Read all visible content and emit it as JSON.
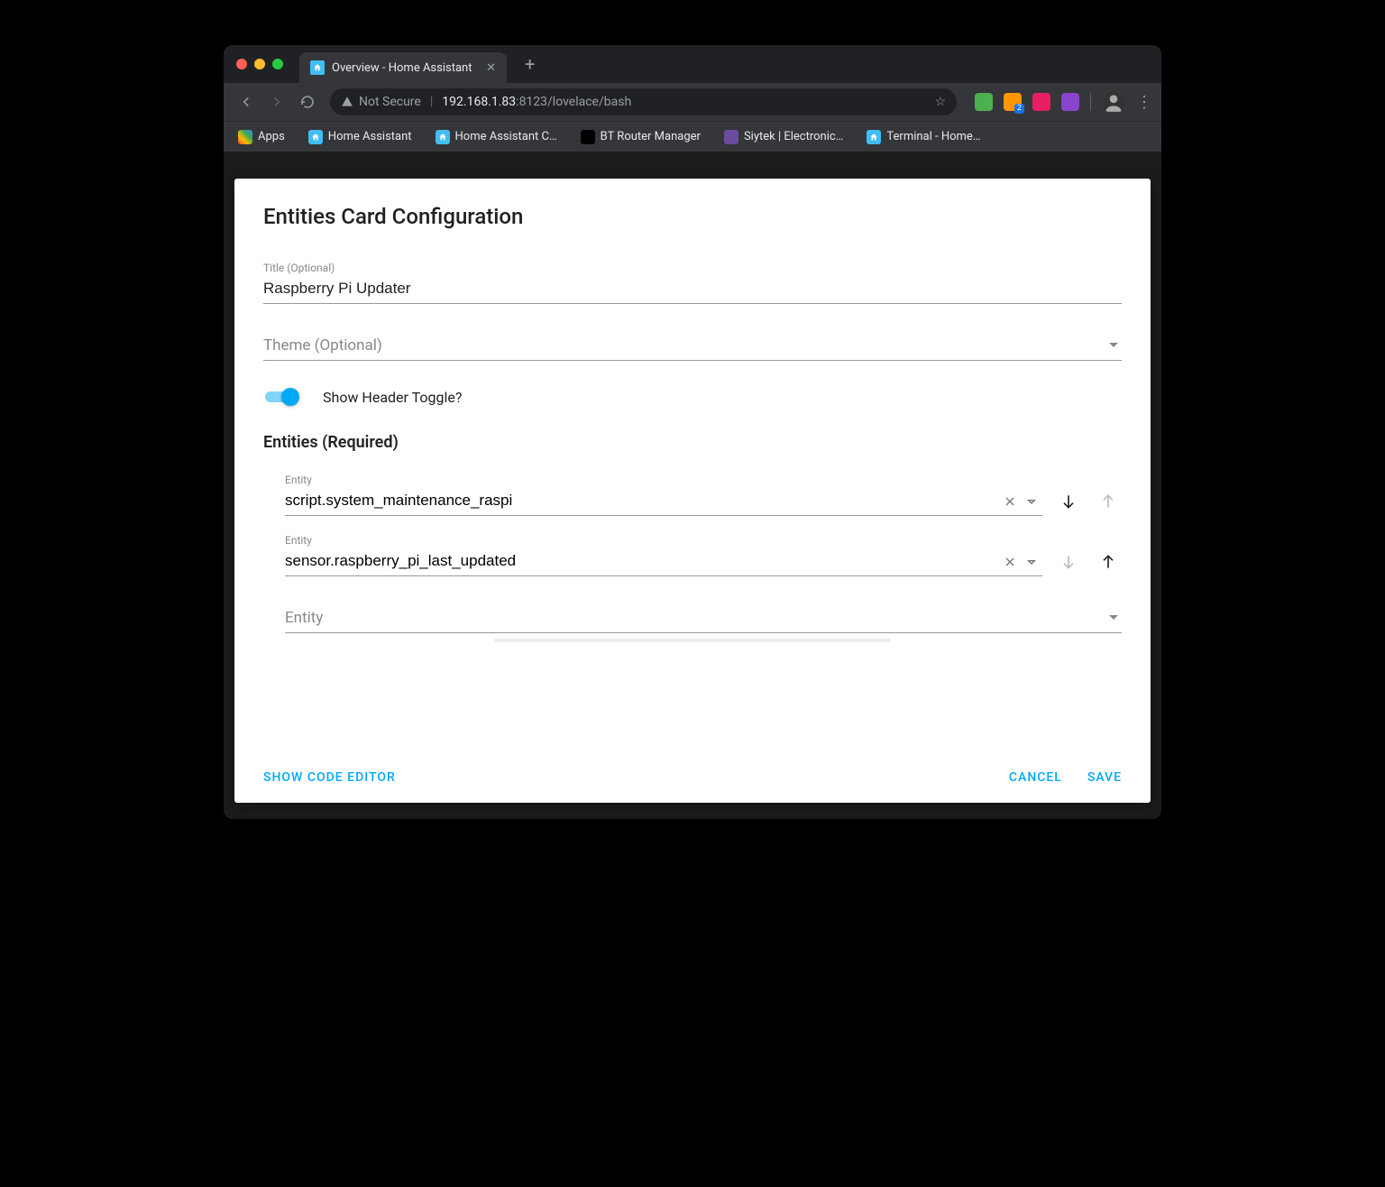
{
  "browser": {
    "tab_title": "Overview - Home Assistant",
    "omnibox": {
      "security_label": "Not Secure",
      "host": "192.168.1.83",
      "path": ":8123/lovelace/bash"
    },
    "bookmarks": [
      {
        "label": "Apps",
        "icon": "apps"
      },
      {
        "label": "Home Assistant",
        "icon": "ha"
      },
      {
        "label": "Home Assistant C…",
        "icon": "ha"
      },
      {
        "label": "BT Router Manager",
        "icon": "bt"
      },
      {
        "label": "Siytek | Electronic…",
        "icon": "siytek"
      },
      {
        "label": "Terminal - Home…",
        "icon": "ha"
      }
    ],
    "extensions": {
      "rss_badge": "2"
    }
  },
  "dialog": {
    "title": "Entities Card Configuration",
    "fields": {
      "title_label": "Title (Optional)",
      "title_value": "Raspberry Pi Updater",
      "theme_label": "Theme (Optional)",
      "toggle_label": "Show Header Toggle?",
      "toggle_on": true,
      "entities_header": "Entities (Required)",
      "entity_field_label": "Entity",
      "entity_placeholder": "Entity"
    },
    "entities": [
      {
        "value": "script.system_maintenance_raspi",
        "can_up": false,
        "can_down": true
      },
      {
        "value": "sensor.raspberry_pi_last_updated",
        "can_up": true,
        "can_down": false
      }
    ],
    "footer": {
      "code_editor": "Show Code Editor",
      "cancel": "Cancel",
      "save": "Save"
    }
  }
}
